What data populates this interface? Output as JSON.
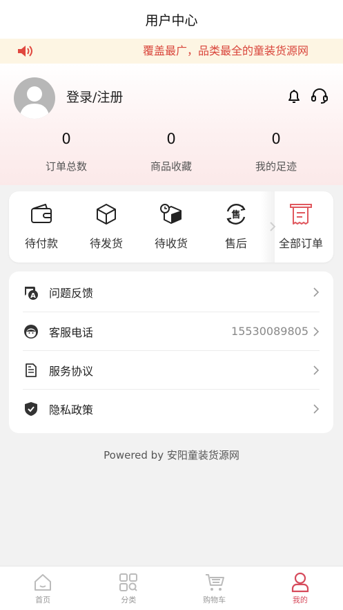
{
  "nav": {
    "title": "用户中心"
  },
  "notice": {
    "text": "覆盖最广，品类最全的童装货源网",
    "icon": "speaker-icon",
    "color": "#d9453b"
  },
  "user": {
    "login_label": "登录/注册"
  },
  "stats": [
    {
      "value": "0",
      "label": "订单总数"
    },
    {
      "value": "0",
      "label": "商品收藏"
    },
    {
      "value": "0",
      "label": "我的足迹"
    }
  ],
  "orders": [
    {
      "label": "待付款",
      "icon": "wallet-icon"
    },
    {
      "label": "待发货",
      "icon": "box-icon"
    },
    {
      "label": "待收货",
      "icon": "delivery-box-icon"
    },
    {
      "label": "售后",
      "icon": "after-sale-icon"
    },
    {
      "label": "全部订单",
      "icon": "receipt-icon"
    }
  ],
  "menu": [
    {
      "label": "问题反馈",
      "icon": "feedback-icon",
      "value": ""
    },
    {
      "label": "客服电话",
      "icon": "service-agent-icon",
      "value": "15530089805"
    },
    {
      "label": "服务协议",
      "icon": "document-icon",
      "value": ""
    },
    {
      "label": "隐私政策",
      "icon": "shield-icon",
      "value": ""
    }
  ],
  "footer": {
    "powered": "Powered by 安阳童装货源网"
  },
  "tabbar": [
    {
      "label": "首页",
      "icon": "home-icon",
      "active": false
    },
    {
      "label": "分类",
      "icon": "category-icon",
      "active": false
    },
    {
      "label": "购物车",
      "icon": "cart-icon",
      "active": false
    },
    {
      "label": "我的",
      "icon": "profile-icon",
      "active": true
    }
  ],
  "colors": {
    "accent": "#d64a5b",
    "notice_bg": "#fdf5e3"
  }
}
